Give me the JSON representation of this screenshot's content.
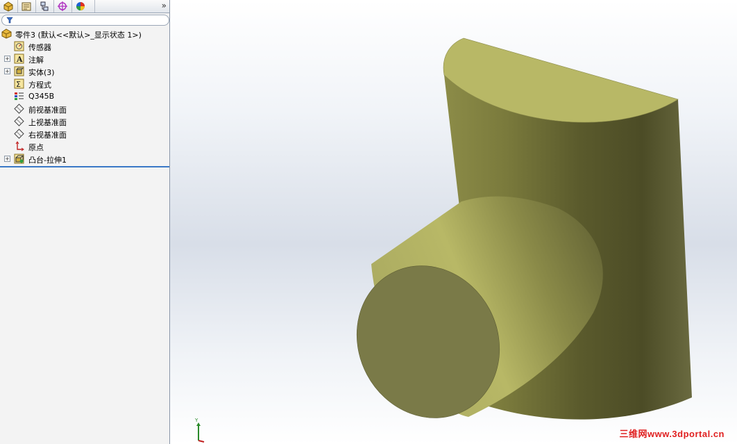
{
  "manager_tabs": [
    {
      "icon": "feature-manager-icon"
    },
    {
      "icon": "property-manager-icon"
    },
    {
      "icon": "configuration-manager-icon"
    },
    {
      "icon": "dimxpert-manager-icon"
    },
    {
      "icon": "display-manager-icon"
    }
  ],
  "expand_label": "»",
  "tree": {
    "root": "零件3  (默认<<默认>_显示状态 1>)",
    "items": [
      {
        "label": "传感器",
        "icon": "sensor-icon",
        "toggle": false
      },
      {
        "label": "注解",
        "icon": "annotation-icon",
        "toggle": true
      },
      {
        "label": "实体(3)",
        "icon": "solid-bodies-icon",
        "toggle": true
      },
      {
        "label": "方程式",
        "icon": "equations-icon",
        "toggle": false
      },
      {
        "label": "Q345B",
        "icon": "material-icon",
        "toggle": false
      },
      {
        "label": "前视基准面",
        "icon": "plane-icon",
        "toggle": false
      },
      {
        "label": "上视基准面",
        "icon": "plane-icon",
        "toggle": false
      },
      {
        "label": "右视基准面",
        "icon": "plane-icon",
        "toggle": false
      },
      {
        "label": "原点",
        "icon": "origin-icon",
        "toggle": false
      },
      {
        "label": "凸台-拉伸1",
        "icon": "extrude-feature-icon",
        "toggle": true
      }
    ]
  },
  "viewport": {
    "triad_label": "Y",
    "model_color": "#b8b866"
  },
  "watermark": "三维网www.3dportal.cn"
}
